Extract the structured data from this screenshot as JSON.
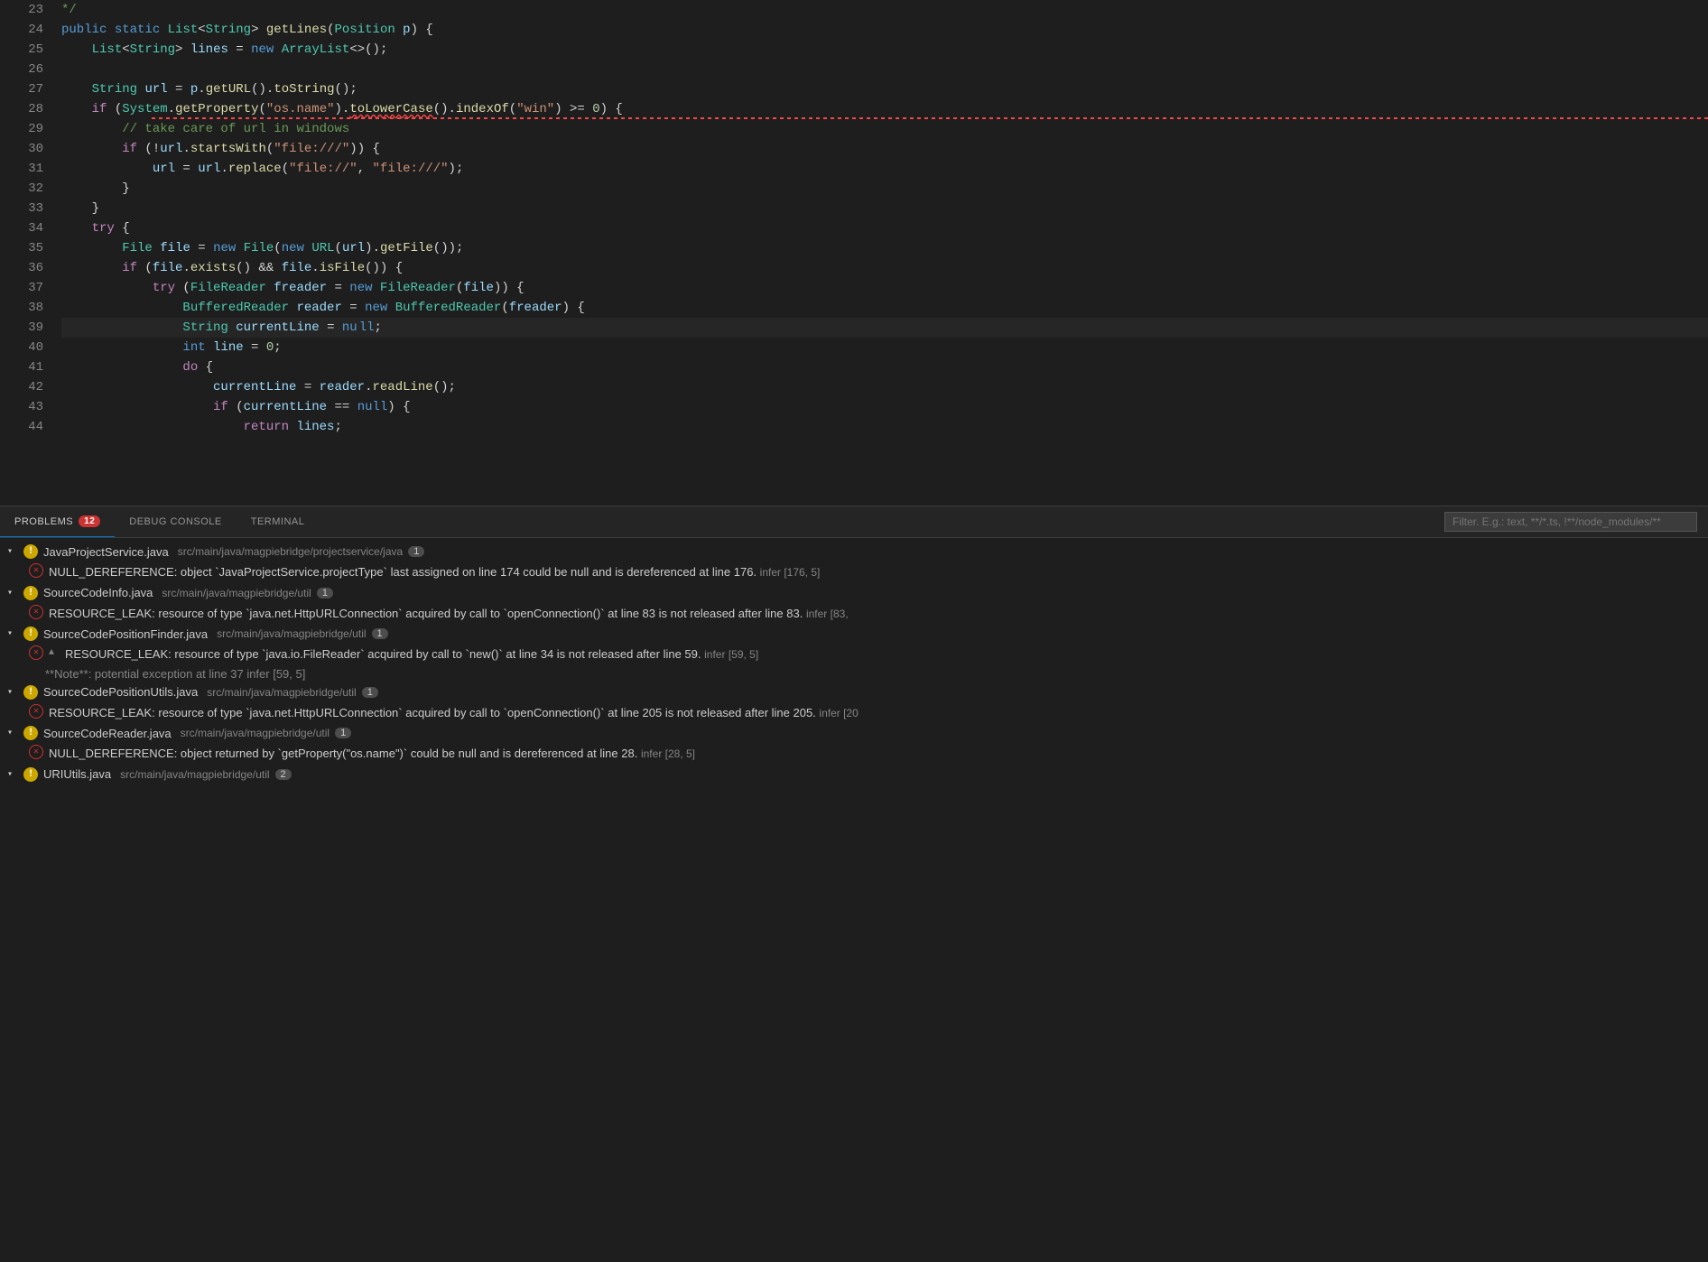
{
  "editor": {
    "lines": [
      {
        "num": 23,
        "content": [
          {
            "t": "comment",
            "v": "*/"
          }
        ]
      },
      {
        "num": 24,
        "content": [
          {
            "t": "kw",
            "v": "public"
          },
          {
            "t": "punct",
            "v": " "
          },
          {
            "t": "kw",
            "v": "static"
          },
          {
            "t": "punct",
            "v": " "
          },
          {
            "t": "type",
            "v": "List"
          },
          {
            "t": "punct",
            "v": "<"
          },
          {
            "t": "type",
            "v": "String"
          },
          {
            "t": "punct",
            "v": "> "
          },
          {
            "t": "fn",
            "v": "getLines"
          },
          {
            "t": "punct",
            "v": "("
          },
          {
            "t": "type",
            "v": "Position"
          },
          {
            "t": "punct",
            "v": " "
          },
          {
            "t": "var",
            "v": "p"
          },
          {
            "t": "punct",
            "v": ") {"
          }
        ]
      },
      {
        "num": 25,
        "content": [
          {
            "t": "type",
            "v": "    List"
          },
          {
            "t": "punct",
            "v": "<"
          },
          {
            "t": "type",
            "v": "String"
          },
          {
            "t": "punct",
            "v": "> "
          },
          {
            "t": "var",
            "v": "lines"
          },
          {
            "t": "punct",
            "v": " = "
          },
          {
            "t": "kw",
            "v": "new"
          },
          {
            "t": "punct",
            "v": " "
          },
          {
            "t": "type",
            "v": "ArrayList"
          },
          {
            "t": "punct",
            "v": "<>(};"
          }
        ]
      },
      {
        "num": 26,
        "content": []
      },
      {
        "num": 27,
        "content": [
          {
            "t": "type",
            "v": "    String"
          },
          {
            "t": "punct",
            "v": " "
          },
          {
            "t": "var",
            "v": "url"
          },
          {
            "t": "punct",
            "v": " = "
          },
          {
            "t": "var",
            "v": "p"
          },
          {
            "t": "punct",
            "v": "."
          },
          {
            "t": "fn",
            "v": "getURL"
          },
          {
            "t": "punct",
            "v": "()."
          },
          {
            "t": "fn",
            "v": "toString"
          },
          {
            "t": "punct",
            "v": "();"
          }
        ]
      },
      {
        "num": 28,
        "content": [
          {
            "t": "kw2",
            "v": "    if"
          },
          {
            "t": "punct",
            "v": " ("
          },
          {
            "t": "type",
            "v": "System"
          },
          {
            "t": "punct",
            "v": "."
          },
          {
            "t": "fn",
            "v": "getProperty"
          },
          {
            "t": "punct",
            "v": "("
          },
          {
            "t": "str",
            "v": "\"os.name\""
          },
          {
            "t": "punct",
            "v": ")."
          },
          {
            "t": "fn",
            "v": "toLo",
            "err": true
          },
          {
            "t": "fn err-underline",
            "v": "werCase"
          },
          {
            "t": "punct",
            "v": "()."
          },
          {
            "t": "fn",
            "v": "indexOf"
          },
          {
            "t": "punct",
            "v": "("
          },
          {
            "t": "str",
            "v": "\"win\""
          },
          {
            "t": "punct",
            "v": ") >= "
          },
          {
            "t": "num",
            "v": "0"
          },
          {
            "t": "punct",
            "v": ") {"
          }
        ]
      },
      {
        "num": 29,
        "content": [
          {
            "t": "comment",
            "v": "        // take care of url in windows"
          }
        ]
      },
      {
        "num": 30,
        "content": [
          {
            "t": "kw2",
            "v": "        if"
          },
          {
            "t": "punct",
            "v": " (!"
          },
          {
            "t": "var",
            "v": "url"
          },
          {
            "t": "punct",
            "v": "."
          },
          {
            "t": "fn",
            "v": "startsWith"
          },
          {
            "t": "punct",
            "v": "("
          },
          {
            "t": "str",
            "v": "\"file:///\""
          },
          {
            "t": "punct",
            "v": ")) {"
          }
        ]
      },
      {
        "num": 31,
        "content": [
          {
            "t": "var",
            "v": "            url"
          },
          {
            "t": "punct",
            "v": " = "
          },
          {
            "t": "var",
            "v": "url"
          },
          {
            "t": "punct",
            "v": "."
          },
          {
            "t": "fn",
            "v": "replace"
          },
          {
            "t": "punct",
            "v": "("
          },
          {
            "t": "str",
            "v": "\"file://\""
          },
          {
            "t": "punct",
            "v": ", "
          },
          {
            "t": "str",
            "v": "\"file:///\""
          },
          {
            "t": "punct",
            "v": ");"
          }
        ]
      },
      {
        "num": 32,
        "content": [
          {
            "t": "punct",
            "v": "        }"
          }
        ]
      },
      {
        "num": 33,
        "content": [
          {
            "t": "punct",
            "v": "    }"
          }
        ]
      },
      {
        "num": 34,
        "content": [
          {
            "t": "kw2",
            "v": "    try"
          },
          {
            "t": "punct",
            "v": " {"
          }
        ]
      },
      {
        "num": 35,
        "content": [
          {
            "t": "type",
            "v": "        File"
          },
          {
            "t": "punct",
            "v": " "
          },
          {
            "t": "var",
            "v": "file"
          },
          {
            "t": "punct",
            "v": " = "
          },
          {
            "t": "kw",
            "v": "new"
          },
          {
            "t": "punct",
            "v": " "
          },
          {
            "t": "type",
            "v": "File"
          },
          {
            "t": "punct",
            "v": "("
          },
          {
            "t": "kw",
            "v": "new"
          },
          {
            "t": "punct",
            "v": " "
          },
          {
            "t": "type",
            "v": "URL"
          },
          {
            "t": "punct",
            "v": "("
          },
          {
            "t": "var",
            "v": "url"
          },
          {
            "t": "punct",
            "v": ")."
          },
          {
            "t": "fn",
            "v": "getFile"
          },
          {
            "t": "punct",
            "v": "());"
          }
        ]
      },
      {
        "num": 36,
        "content": [
          {
            "t": "kw2",
            "v": "        if"
          },
          {
            "t": "punct",
            "v": " ("
          },
          {
            "t": "var",
            "v": "file"
          },
          {
            "t": "punct",
            "v": "."
          },
          {
            "t": "fn",
            "v": "exists"
          },
          {
            "t": "punct",
            "v": "() && "
          },
          {
            "t": "var",
            "v": "file"
          },
          {
            "t": "punct",
            "v": "."
          },
          {
            "t": "fn",
            "v": "isFile"
          },
          {
            "t": "punct",
            "v": "()) {"
          }
        ]
      },
      {
        "num": 37,
        "content": [
          {
            "t": "kw2",
            "v": "            try"
          },
          {
            "t": "punct",
            "v": " ("
          },
          {
            "t": "type",
            "v": "FileReader"
          },
          {
            "t": "punct",
            "v": " "
          },
          {
            "t": "var",
            "v": "freader"
          },
          {
            "t": "punct",
            "v": " = "
          },
          {
            "t": "kw",
            "v": "new"
          },
          {
            "t": "punct",
            "v": " "
          },
          {
            "t": "type",
            "v": "FileReader"
          },
          {
            "t": "punct",
            "v": "("
          },
          {
            "t": "var",
            "v": "file"
          },
          {
            "t": "punct",
            "v": ")) {"
          }
        ]
      },
      {
        "num": 38,
        "content": [
          {
            "t": "type",
            "v": "                BufferedReader"
          },
          {
            "t": "punct",
            "v": " "
          },
          {
            "t": "var",
            "v": "reader"
          },
          {
            "t": "punct",
            "v": " = "
          },
          {
            "t": "kw",
            "v": "new"
          },
          {
            "t": "punct",
            "v": " "
          },
          {
            "t": "type",
            "v": "BufferedReader"
          },
          {
            "t": "punct",
            "v": "("
          },
          {
            "t": "var",
            "v": "freader"
          },
          {
            "t": "punct",
            "v": ") {"
          }
        ]
      },
      {
        "num": 39,
        "content": [
          {
            "t": "type",
            "v": "                String"
          },
          {
            "t": "punct",
            "v": " "
          },
          {
            "t": "var",
            "v": "currentLine"
          },
          {
            "t": "punct",
            "v": " = "
          },
          {
            "t": "kw",
            "v": "null"
          },
          {
            "t": "punct",
            "v": ";"
          }
        ],
        "cursor": true
      },
      {
        "num": 40,
        "content": [
          {
            "t": "kw",
            "v": "                int"
          },
          {
            "t": "punct",
            "v": " "
          },
          {
            "t": "var",
            "v": "line"
          },
          {
            "t": "punct",
            "v": " = "
          },
          {
            "t": "num",
            "v": "0"
          },
          {
            "t": "punct",
            "v": ";"
          }
        ]
      },
      {
        "num": 41,
        "content": [
          {
            "t": "kw2",
            "v": "                do"
          },
          {
            "t": "punct",
            "v": " {"
          }
        ]
      },
      {
        "num": 42,
        "content": [
          {
            "t": "var",
            "v": "                    currentLine"
          },
          {
            "t": "punct",
            "v": " = "
          },
          {
            "t": "var",
            "v": "reader"
          },
          {
            "t": "punct",
            "v": "."
          },
          {
            "t": "fn",
            "v": "readLine"
          },
          {
            "t": "punct",
            "v": "();"
          }
        ]
      },
      {
        "num": 43,
        "content": [
          {
            "t": "kw2",
            "v": "                    if"
          },
          {
            "t": "punct",
            "v": " ("
          },
          {
            "t": "var",
            "v": "currentLine"
          },
          {
            "t": "punct",
            "v": " == "
          },
          {
            "t": "kw",
            "v": "null"
          },
          {
            "t": "punct",
            "v": ") {"
          }
        ]
      },
      {
        "num": 44,
        "content": [
          {
            "t": "kw2",
            "v": "                        return"
          },
          {
            "t": "punct",
            "v": " "
          },
          {
            "t": "var",
            "v": "lines"
          },
          {
            "t": "punct",
            "v": ";"
          }
        ]
      }
    ]
  },
  "panel": {
    "tabs": [
      {
        "id": "problems",
        "label": "PROBLEMS",
        "badge": "12",
        "active": true
      },
      {
        "id": "debug",
        "label": "DEBUG CONSOLE",
        "active": false
      },
      {
        "id": "terminal",
        "label": "TERMINAL",
        "active": false
      }
    ],
    "filter_placeholder": "Filter. E.g.: text, **/*.ts, !**/node_modules/**",
    "file_groups": [
      {
        "id": "JavaProjectService",
        "expanded": true,
        "severity": "error",
        "filename": "JavaProjectService.java",
        "path": "src/main/java/magpiebridge/projectservice/java",
        "count": "1",
        "problems": [
          {
            "id": "null-deref-1",
            "severity": "error",
            "message": "NULL_DEREFERENCE: object `JavaProjectService.projectType` last assigned on line 174 could be null and is dereferenced at line 176.",
            "source": "infer",
            "location": "[176, 5]"
          }
        ]
      },
      {
        "id": "SourceCodeInfo",
        "expanded": true,
        "severity": "error",
        "filename": "SourceCodeInfo.java",
        "path": "src/main/java/magpiebridge/util",
        "count": "1",
        "problems": [
          {
            "id": "resource-leak-1",
            "severity": "error",
            "message": "RESOURCE_LEAK: resource of type `java.net.HttpURLConnection` acquired by call to `openConnection()` at line 83 is not released after line 83.",
            "source": "infer",
            "location": "[83,"
          }
        ]
      },
      {
        "id": "SourceCodePositionFinder",
        "expanded": true,
        "severity": "error",
        "filename": "SourceCodePositionFinder.java",
        "path": "src/main/java/magpiebridge/util",
        "count": "1",
        "problems": [
          {
            "id": "resource-leak-2",
            "severity": "error",
            "expandable": true,
            "message": "RESOURCE_LEAK: resource of type `java.io.FileReader` acquired by call to `new()` at line 34 is not released after line 59.",
            "source": "infer",
            "location": "[59, 5]",
            "note": "**Note**: potential exception at line 37  infer  [59, 5]"
          }
        ]
      },
      {
        "id": "SourceCodePositionUtils",
        "expanded": true,
        "severity": "error",
        "filename": "SourceCodePositionUtils.java",
        "path": "src/main/java/magpiebridge/util",
        "count": "1",
        "problems": [
          {
            "id": "resource-leak-3",
            "severity": "error",
            "message": "RESOURCE_LEAK: resource of type `java.net.HttpURLConnection` acquired by call to `openConnection()` at line 205 is not released after line 205.",
            "source": "infer",
            "location": "[20"
          }
        ]
      },
      {
        "id": "SourceCodeReader",
        "expanded": true,
        "severity": "error",
        "filename": "SourceCodeReader.java",
        "path": "src/main/java/magpiebridge/util",
        "count": "1",
        "problems": [
          {
            "id": "null-deref-2",
            "severity": "error",
            "message": "NULL_DEREFERENCE: object returned by `getProperty(\"os.name\")` could be null and is dereferenced at line 28.",
            "source": "infer",
            "location": "[28, 5]"
          }
        ]
      },
      {
        "id": "URIUtils",
        "expanded": false,
        "severity": "error",
        "filename": "URIUtils.java",
        "path": "src/main/java/magpiebridge/util",
        "count": "2",
        "problems": []
      }
    ]
  }
}
